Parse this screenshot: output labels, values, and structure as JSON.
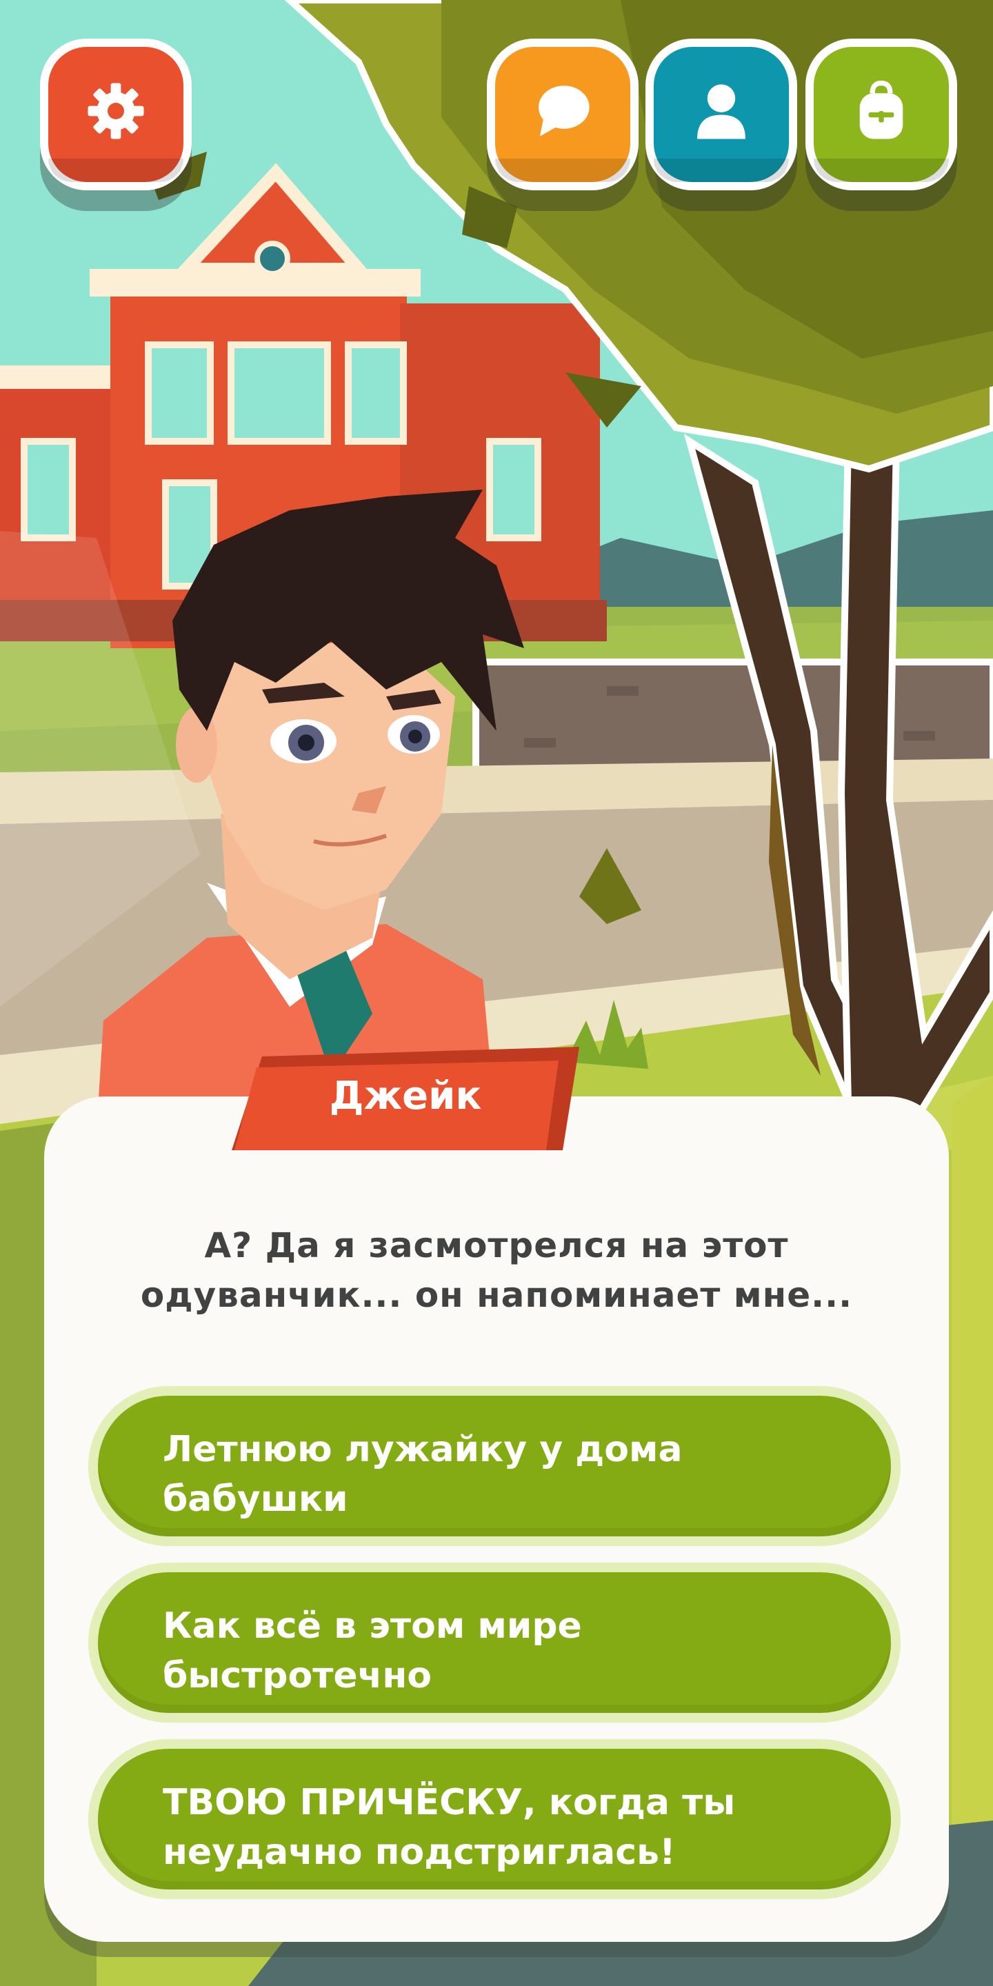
{
  "hud": {
    "settings_icon": "gear-icon",
    "chat_icon": "speech-bubble-icon",
    "profile_icon": "person-icon",
    "backpack_icon": "backpack-icon"
  },
  "dialog": {
    "speaker": "Джейк",
    "line_1": "А? Да я засмотрелся на этот",
    "line_2": "одуванчик... он напоминает мне..."
  },
  "choices": [
    {
      "line_1": "Летнюю лужайку у дома",
      "line_2": "бабушки"
    },
    {
      "line_1": "Как всё в этом мире",
      "line_2": "быстротечно"
    },
    {
      "line_1": "ТВОЮ ПРИЧЁСКУ, когда ты",
      "line_2": "неудачно подстриглась!"
    }
  ],
  "colors": {
    "settings": "#E9502E",
    "chat": "#F7981F",
    "profile": "#0E97AC",
    "backpack": "#8DB51C",
    "choice": "#84AB14",
    "name_tag": "#E9502E"
  }
}
